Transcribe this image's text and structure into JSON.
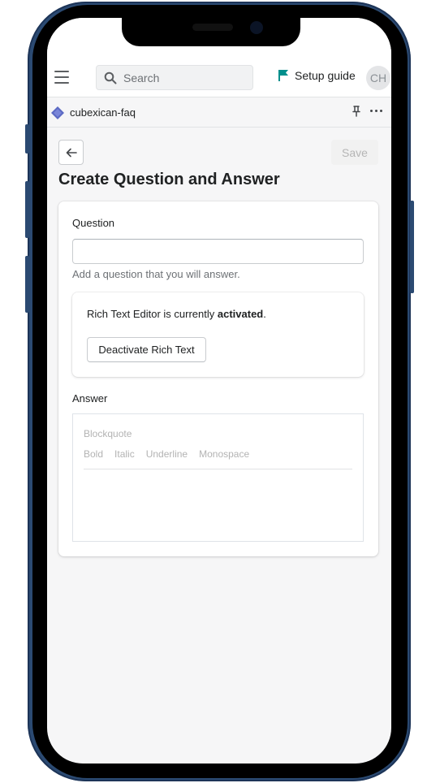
{
  "topbar": {
    "search_placeholder": "Search",
    "setup_guide_label": "Setup guide",
    "avatar_initials": "CH",
    "flag_color": "#008f8c"
  },
  "appbar": {
    "app_name": "cubexican-faq",
    "app_icon_color": "#5c6ac4"
  },
  "page": {
    "title": "Create Question and Answer",
    "save_label": "Save"
  },
  "form": {
    "question_label": "Question",
    "question_value": "",
    "question_help": "Add a question that you will answer.",
    "rte_status_prefix": "Rich Text Editor is currently ",
    "rte_status_state": "activated",
    "rte_status_suffix": ".",
    "deactivate_label": "Deactivate Rich Text",
    "answer_label": "Answer",
    "answer_value": "",
    "toolbar": {
      "blockquote": "Blockquote",
      "bold": "Bold",
      "italic": "Italic",
      "underline": "Underline",
      "monospace": "Monospace"
    }
  }
}
